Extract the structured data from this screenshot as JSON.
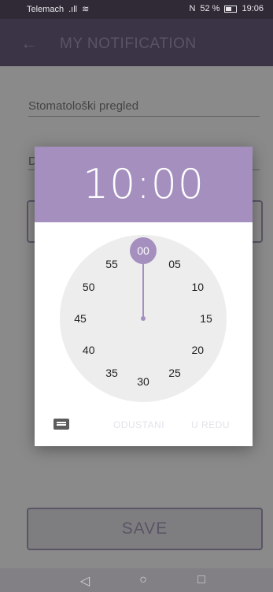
{
  "status": {
    "carrier": "Telemach",
    "signal": ".ıll",
    "wifi": "≋",
    "nfc": "N",
    "battery": "52 %",
    "time": "19:06"
  },
  "appbar": {
    "back_icon": "←",
    "title": "MY NOTIFICATION"
  },
  "form": {
    "field1_value": "Stomatološki pregled",
    "field2_hint": "D",
    "save_label": "SAVE"
  },
  "dialog": {
    "time": "10:00",
    "selected": "00",
    "numbers": [
      "05",
      "10",
      "15",
      "20",
      "25",
      "30",
      "35",
      "40",
      "45",
      "50",
      "55"
    ],
    "cancel_label": "ODUSTANI",
    "ok_label": "U REDU"
  },
  "navbar": {
    "back": "◁",
    "home": "○",
    "recent": "□"
  },
  "colors": {
    "accent": "#a48fbf",
    "appbar": "#3a3446"
  }
}
